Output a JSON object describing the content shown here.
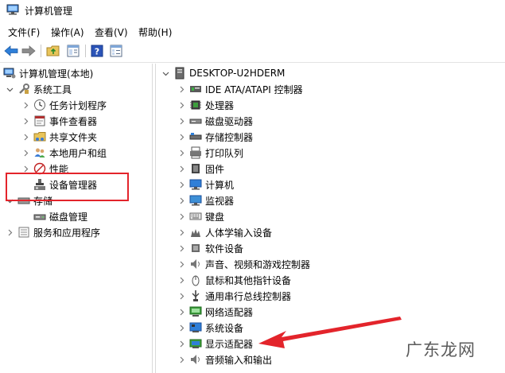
{
  "window": {
    "title": "计算机管理"
  },
  "menu": [
    "文件(F)",
    "操作(A)",
    "查看(V)",
    "帮助(H)"
  ],
  "toolbar": {
    "buttons": [
      "back-icon",
      "forward-icon",
      "up-folder-icon",
      "show-hide-tree-icon",
      "help-icon",
      "properties-icon"
    ]
  },
  "left_tree": {
    "root": "计算机管理(本地)",
    "system_tools": "系统工具",
    "task_scheduler": "任务计划程序",
    "event_viewer": "事件查看器",
    "shared_folders": "共享文件夹",
    "local_users": "本地用户和组",
    "performance": "性能",
    "device_manager": "设备管理器",
    "storage": "存储",
    "disk_management": "磁盘管理",
    "services": "服务和应用程序"
  },
  "right_tree": {
    "computer_name": "DESKTOP-U2HDERM",
    "items": [
      "IDE ATA/ATAPI 控制器",
      "处理器",
      "磁盘驱动器",
      "存储控制器",
      "打印队列",
      "固件",
      "计算机",
      "监视器",
      "键盘",
      "人体学输入设备",
      "软件设备",
      "声音、视频和游戏控制器",
      "鼠标和其他指针设备",
      "通用串行总线控制器",
      "网络适配器",
      "系统设备",
      "显示适配器",
      "音频输入和输出"
    ]
  },
  "watermark": "广东龙网",
  "colors": {
    "highlight": "#e3242b",
    "arrow_annotation": "#e3242b"
  }
}
